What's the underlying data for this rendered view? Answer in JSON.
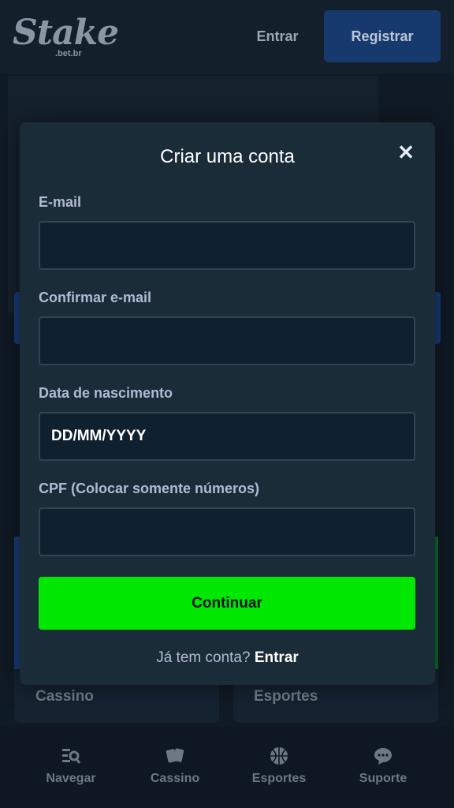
{
  "header": {
    "logo_text": "Stake",
    "logo_sub": ".bet.br",
    "login_label": "Entrar",
    "register_label": "Registrar"
  },
  "background": {
    "card_left_label": "Cassino",
    "card_right_label": "Esportes"
  },
  "bottom_nav": {
    "items": [
      {
        "label": "Navegar",
        "icon": "browse-icon"
      },
      {
        "label": "Cassino",
        "icon": "cards-icon"
      },
      {
        "label": "Esportes",
        "icon": "basketball-icon"
      },
      {
        "label": "Suporte",
        "icon": "chat-icon"
      }
    ]
  },
  "modal": {
    "title": "Criar uma conta",
    "close_icon": "close-icon",
    "fields": {
      "email_label": "E-mail",
      "email_value": "",
      "confirm_email_label": "Confirmar e-mail",
      "confirm_email_value": "",
      "dob_label": "Data de nascimento",
      "dob_placeholder": "DD/MM/YYYY",
      "cpf_label": "CPF (Colocar somente números)",
      "cpf_value": ""
    },
    "continue_label": "Continuar",
    "login_prompt": "Já tem conta?",
    "login_link": "Entrar"
  },
  "colors": {
    "accent_green": "#00e701",
    "modal_bg": "#1a2c38",
    "input_bg": "#0f212e",
    "register_blue": "#173a6e"
  }
}
